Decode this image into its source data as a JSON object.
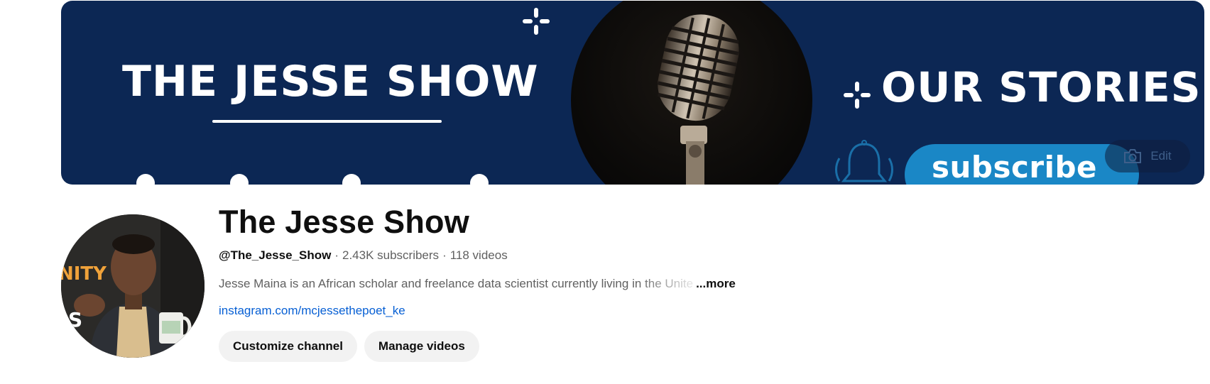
{
  "banner": {
    "left_title": "THE JESSE SHOW",
    "right_title": "OUR STORIES",
    "subscribe_label": "subscribe",
    "edit_label": "Edit",
    "colors": {
      "background": "#0c2754",
      "subscribe": "#1a87c6"
    },
    "icons": [
      "sparkle-icon",
      "microphone-icon",
      "bell-icon",
      "camera-icon"
    ]
  },
  "channel": {
    "title": "The Jesse Show",
    "handle": "@The_Jesse_Show",
    "subscribers": "2.43K subscribers",
    "videos": "118 videos",
    "separator": "·",
    "description": "Jesse Maina is an African scholar and freelance data scientist currently living in the Unite",
    "more_label": "...more",
    "link": "instagram.com/mcjessethepoet_ke",
    "avatar_text_top": "NITY",
    "avatar_text_bottom": "S"
  },
  "actions": {
    "customize_label": "Customize channel",
    "manage_label": "Manage videos"
  }
}
